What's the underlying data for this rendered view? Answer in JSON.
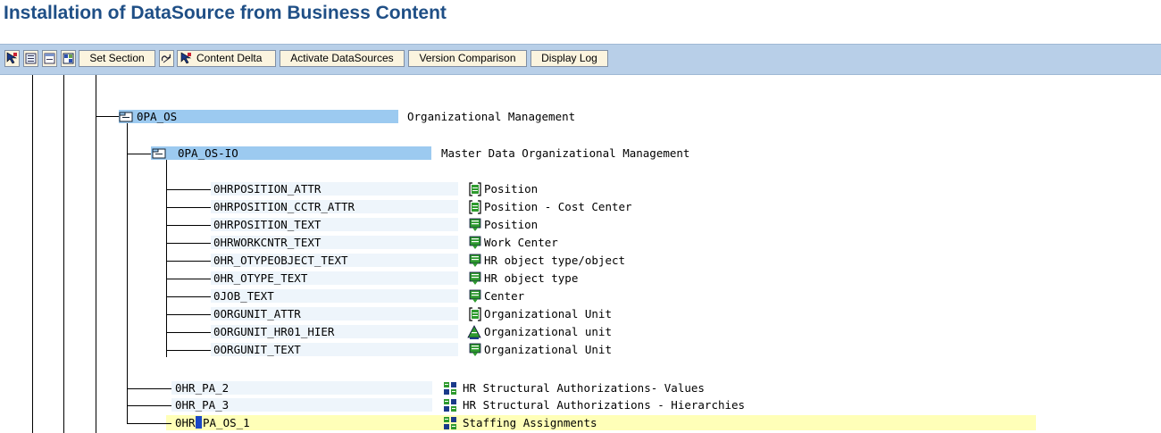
{
  "title": "Installation of DataSource from Business Content",
  "toolbar": {
    "set_section": "Set Section",
    "content_delta": "Content Delta",
    "activate": "Activate DataSources",
    "version_comparison": "Version Comparison",
    "display_log": "Display Log"
  },
  "tree": {
    "node1": {
      "name": "0PA_OS",
      "desc": "Organizational Management"
    },
    "node2": {
      "name": "0PA_OS-IO",
      "desc": "Master Data Organizational Management"
    },
    "leaves": [
      {
        "name": "0HRPOSITION_ATTR",
        "desc": "Position",
        "icon": "attribute-icon"
      },
      {
        "name": "0HRPOSITION_CCTR_ATTR",
        "desc": "Position - Cost Center",
        "icon": "attribute-icon"
      },
      {
        "name": "0HRPOSITION_TEXT",
        "desc": "Position",
        "icon": "text-icon"
      },
      {
        "name": "0HRWORKCNTR_TEXT",
        "desc": "Work Center",
        "icon": "text-icon"
      },
      {
        "name": "0HR_OTYPEOBJECT_TEXT",
        "desc": "HR object type/object",
        "icon": "text-icon"
      },
      {
        "name": "0HR_OTYPE_TEXT",
        "desc": "HR object type",
        "icon": "text-icon"
      },
      {
        "name": "0JOB_TEXT",
        "desc": "Center",
        "icon": "text-icon"
      },
      {
        "name": "0ORGUNIT_ATTR",
        "desc": "Organizational Unit",
        "icon": "attribute-icon"
      },
      {
        "name": "0ORGUNIT_HR01_HIER",
        "desc": "Organizational unit",
        "icon": "hierarchy-icon"
      },
      {
        "name": "0ORGUNIT_TEXT",
        "desc": "Organizational Unit",
        "icon": "text-icon"
      }
    ],
    "bottom": [
      {
        "name": "0HR_PA_2",
        "desc": "HR Structural Authorizations- Values",
        "icon": "transaction-data-icon"
      },
      {
        "name": "0HR_PA_3",
        "desc": "HR Structural Authorizations - Hierarchies",
        "icon": "transaction-data-icon"
      }
    ],
    "selected": {
      "name_prefix": "0HR",
      "name_suffix": "PA_OS_1",
      "desc": "Staffing Assignments",
      "icon": "transaction-data-icon"
    }
  }
}
